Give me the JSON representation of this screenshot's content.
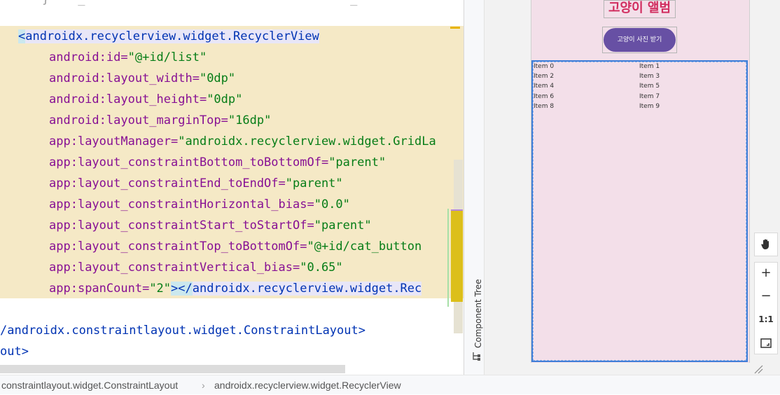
{
  "editor": {
    "top_line": "}",
    "lines": [
      {
        "lt": "<",
        "tag": "androidx.recyclerview.widget.RecyclerView"
      },
      {
        "ns": "android:",
        "attr": "id=",
        "val": "\"@+id/list\""
      },
      {
        "ns": "android:",
        "attr": "layout_width=",
        "val": "\"0dp\""
      },
      {
        "ns": "android:",
        "attr": "layout_height=",
        "val": "\"0dp\""
      },
      {
        "ns": "android:",
        "attr": "layout_marginTop=",
        "val": "\"16dp\""
      },
      {
        "ns": "app:",
        "attr": "layoutManager=",
        "val": "\"androidx.recyclerview.widget.GridLa"
      },
      {
        "ns": "app:",
        "attr": "layout_constraintBottom_toBottomOf=",
        "val": "\"parent\""
      },
      {
        "ns": "app:",
        "attr": "layout_constraintEnd_toEndOf=",
        "val": "\"parent\""
      },
      {
        "ns": "app:",
        "attr": "layout_constraintHorizontal_bias=",
        "val": "\"0.0\""
      },
      {
        "ns": "app:",
        "attr": "layout_constraintStart_toStartOf=",
        "val": "\"parent\""
      },
      {
        "ns": "app:",
        "attr": "layout_constraintTop_toBottomOf=",
        "val": "\"@+id/cat_button"
      },
      {
        "ns": "app:",
        "attr": "layout_constraintVertical_bias=",
        "val": "\"0.65\""
      },
      {
        "ns": "app:",
        "attr": "spanCount=",
        "val": "\"2\"",
        "tail": "></",
        "tail_tag": "androidx.recyclerview.widget.Rec"
      }
    ],
    "close_constraint": "/androidx.constraintlayout.widget.ConstraintLayout>",
    "close_layout": "out>"
  },
  "side_panel": {
    "component_tree_label": "Component Tree",
    "tree_icon": "tree-icon"
  },
  "preview": {
    "title": "고양이 앨범",
    "button_label": "고양이 사진 받기",
    "items": [
      "Item 0",
      "Item 1",
      "Item 2",
      "Item 3",
      "Item 4",
      "Item 5",
      "Item 6",
      "Item 7",
      "Item 8",
      "Item 9"
    ],
    "colors": {
      "background": "#f3dfe9",
      "title": "#d12d5f",
      "button": "#6750a4",
      "selection": "#3f7ed8"
    }
  },
  "toolbar": {
    "pan_icon": "hand-icon",
    "zoom_in": "+",
    "zoom_out": "−",
    "actual_size": "1:1",
    "fit_screen_icon": "fit-screen-icon"
  },
  "statusbar": {
    "crumbs": [
      "constraintlayout.widget.ConstraintLayout",
      "androidx.recyclerview.widget.RecyclerView"
    ],
    "separator": "›"
  }
}
